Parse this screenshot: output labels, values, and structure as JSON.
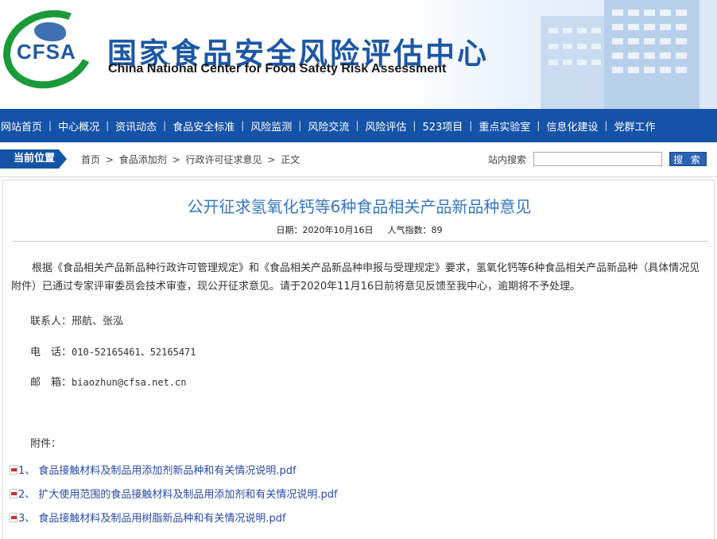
{
  "header": {
    "logo_text": "CFSA",
    "title": "国家食品安全风险评估中心",
    "subtitle": "China National Center for Food Safety Risk Assessment"
  },
  "nav": {
    "items": [
      "网站首页",
      "中心概况",
      "资讯动态",
      "食品安全标准",
      "风险监测",
      "风险交流",
      "风险评估",
      "523项目",
      "重点实验室",
      "信息化建设",
      "党群工作"
    ]
  },
  "breadcrumb": {
    "label": "当前位置",
    "items": [
      "首页",
      "食品添加剂",
      "行政许可征求意见",
      "正文"
    ],
    "separator": ">"
  },
  "search": {
    "label": "站内搜索",
    "value": "",
    "button": "搜 索"
  },
  "article": {
    "title": "公开征求氢氧化钙等6种食品相关产品新品种意见",
    "date_label": "日期：2020年10月16日",
    "views_label": "人气指数：89",
    "body": "根据《食品相关产品新品种行政许可管理规定》和《食品相关产品新品种申报与受理规定》要求，氢氧化钙等6种食品相关产品新品种（具体情况见附件）已通过专家评审委员会技术审查，现公开征求意见。请于2020年11月16日前将意见反馈至我中心，逾期将不予处理。",
    "contact_label": "联系人：",
    "contact_value": "邢航、张泓",
    "phone_label": "电　话：",
    "phone_value": "010-52165461、52165471",
    "email_label": "邮　箱：",
    "email_value": "biaozhun@cfsa.net.cn",
    "attachments_label": "附件：",
    "attachments": [
      "1、 食品接触材料及制品用添加剂新品种和有关情况说明.pdf",
      "2、 扩大使用范围的食品接触材料及制品用添加剂和有关情况说明.pdf",
      "3、 食品接触材料及制品用树脂新品种和有关情况说明.pdf"
    ]
  },
  "colors": {
    "nav_bg": "#1553a8",
    "title_blue": "#3677c5",
    "logo_green": "#1b9a3a",
    "link": "#2a49a8"
  }
}
